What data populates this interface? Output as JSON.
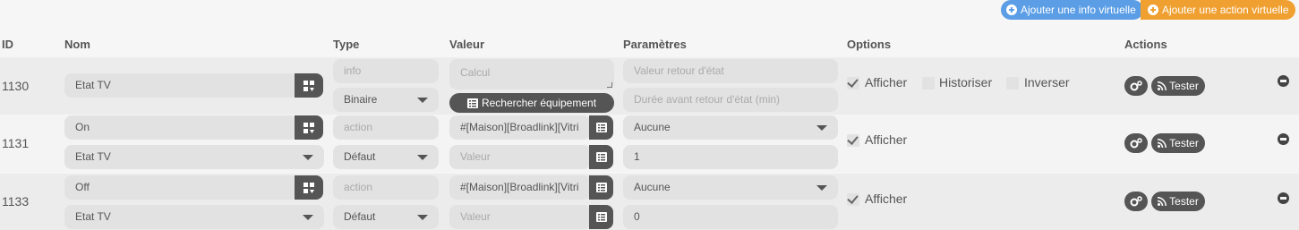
{
  "toolbar": {
    "add_info_label": "Ajouter une info virtuelle",
    "add_action_label": "Ajouter une action virtuelle"
  },
  "table": {
    "headers": {
      "id": "ID",
      "name": "Nom",
      "type": "Type",
      "value": "Valeur",
      "params": "Paramètres",
      "options": "Options",
      "actions": "Actions"
    },
    "rows": [
      {
        "id": "1130",
        "name": "Etat TV",
        "type": "info",
        "subtype": "Binaire",
        "value_placeholder": "Calcul",
        "search_label": "Rechercher équipement",
        "param1_placeholder": "Valeur retour d'état",
        "param2_placeholder": "Durée avant retour d'état (min)",
        "opt_show": "Afficher",
        "opt_history": "Historiser",
        "opt_invert": "Inverser",
        "test_label": "Tester"
      },
      {
        "id": "1131",
        "name": "On",
        "info_link": "Etat TV",
        "type": "action",
        "subtype": "Défaut",
        "value": "#[Maison][Broadlink][Vitri",
        "value2_placeholder": "Valeur",
        "param1": "Aucune",
        "param2": "1",
        "opt_show": "Afficher",
        "test_label": "Tester"
      },
      {
        "id": "1133",
        "name": "Off",
        "info_link": "Etat TV",
        "type": "action",
        "subtype": "Défaut",
        "value": "#[Maison][Broadlink][Vitri",
        "value2_placeholder": "Valeur",
        "param1": "Aucune",
        "param2": "0",
        "opt_show": "Afficher",
        "test_label": "Tester"
      }
    ]
  },
  "colors": {
    "info_button": "#5b9ee6",
    "action_button": "#f0a030",
    "dark_button": "#555555"
  }
}
